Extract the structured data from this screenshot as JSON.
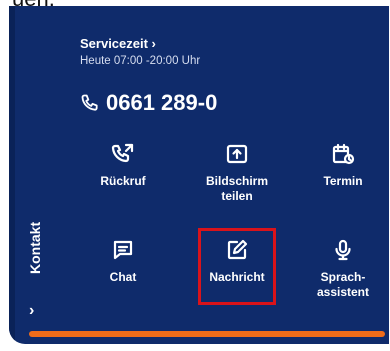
{
  "page": {
    "top_text": "uen."
  },
  "sidebar": {
    "label": "Kontakt",
    "chevron": "›"
  },
  "service": {
    "link_label": "Servicezeit ›",
    "hours": "Heute  07:00 -20:00 Uhr",
    "phone": "0661 289-0"
  },
  "actions": [
    {
      "label": "Rückruf",
      "icon": "callback-icon"
    },
    {
      "label": "Bildschirm teilen",
      "icon": "screen-share-icon"
    },
    {
      "label": "Termin",
      "icon": "calendar-icon"
    },
    {
      "label": "Chat",
      "icon": "chat-icon"
    },
    {
      "label": "Nachricht",
      "icon": "compose-icon"
    },
    {
      "label": "Sprach- assistent",
      "icon": "microphone-icon"
    }
  ],
  "colors": {
    "panel": "#0f2b6b",
    "accent": "#ef6c1a",
    "highlight": "#d9131a",
    "text": "#ffffff"
  }
}
